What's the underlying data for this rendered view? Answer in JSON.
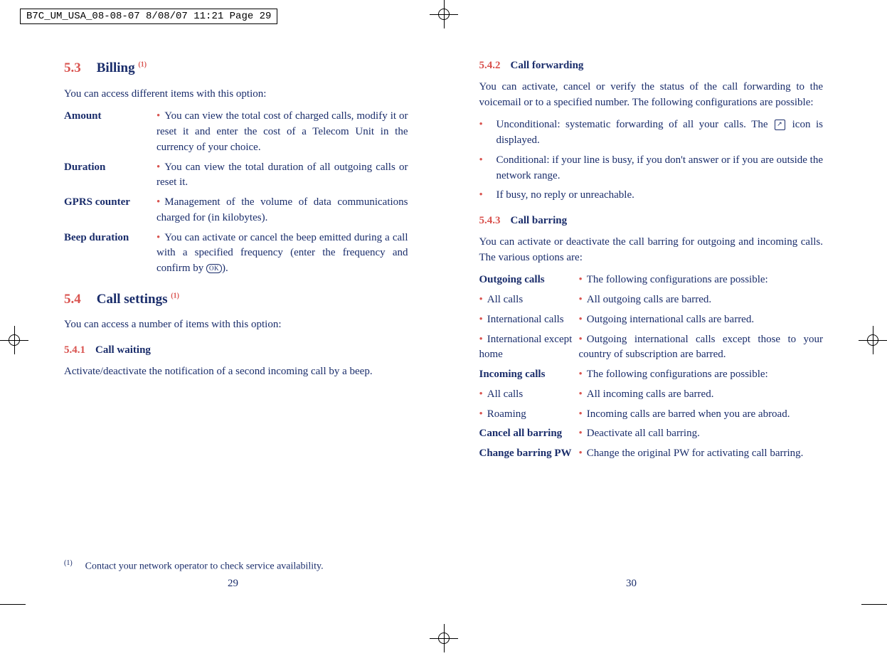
{
  "printerMark": "B7C_UM_USA_08-08-07  8/08/07  11:21  Page 29",
  "left": {
    "sec53": {
      "num": "5.3",
      "title": "Billing",
      "sup": "(1)"
    },
    "intro53": "You can access different items with this option:",
    "defs53": [
      {
        "term": "Amount",
        "body": "You can view the total cost of charged calls, modify it or reset it and enter the cost of a Telecom Unit in the currency of your choice."
      },
      {
        "term": "Duration",
        "body": "You can view the total duration of all outgoing calls or reset it."
      },
      {
        "term": "GPRS counter",
        "body": "Management of the volume of data communications charged for (in kilobytes)."
      },
      {
        "term": "Beep duration",
        "bodyA": "You can activate or cancel the beep emitted during a call with a specified frequency (enter the frequency and confirm by ",
        "bodyB": ")."
      }
    ],
    "sec54": {
      "num": "5.4",
      "title": "Call settings",
      "sup": "(1)"
    },
    "intro54": "You can access a number of items with this option:",
    "sub541": {
      "num": "5.4.1",
      "title": "Call waiting"
    },
    "body541": "Activate/deactivate the notification of a second incoming call by a beep.",
    "footnote": {
      "sup": "(1)",
      "text": "Contact your network operator to check service availability."
    },
    "pageNum": "29"
  },
  "right": {
    "sub542": {
      "num": "5.4.2",
      "title": "Call forwarding"
    },
    "body542": "You can activate, cancel or verify the status of the call forwarding to the voicemail or to a specified number. The following configurations are possible:",
    "list542": [
      {
        "a": "Unconditional: systematic forwarding of all your calls. The ",
        "b": " icon is displayed.",
        "icon": true
      },
      {
        "a": "Conditional: if your line is busy, if you don't answer or if you are outside the network range."
      },
      {
        "a": "If busy, no reply or unreachable."
      }
    ],
    "sub543": {
      "num": "5.4.3",
      "title": "Call barring"
    },
    "body543": "You can activate or deactivate the call barring for outgoing and incoming calls. The various options are:",
    "defs543": [
      {
        "term": "Outgoing calls",
        "bold": true,
        "body": "The following configurations are possible:"
      },
      {
        "term": "All calls",
        "lead": true,
        "body": "All outgoing calls are barred."
      },
      {
        "term": "International calls",
        "lead": true,
        "body": "Outgoing international calls are barred."
      },
      {
        "term": "International except home",
        "lead": true,
        "body": "Outgoing international calls except those to your country of subscription are barred."
      },
      {
        "term": "Incoming calls",
        "bold": true,
        "body": "The following configurations are possible:"
      },
      {
        "term": "All calls",
        "lead": true,
        "body": "All incoming calls are barred."
      },
      {
        "term": "Roaming",
        "lead": true,
        "body": "Incoming calls are barred when you are abroad."
      },
      {
        "term": "Cancel all barring",
        "bold": true,
        "body": "Deactivate all call barring."
      },
      {
        "term": "Change barring PW",
        "bold": true,
        "body": "Change the original PW for activating call barring."
      }
    ],
    "pageNum": "30"
  }
}
